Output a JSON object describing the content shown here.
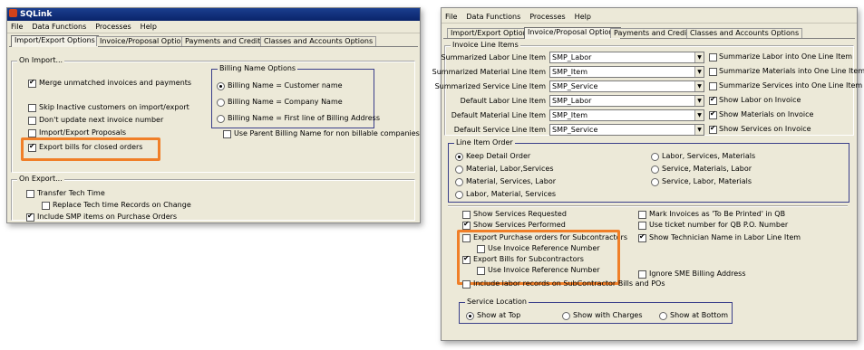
{
  "colors": {
    "highlight": "#f07f28",
    "title_bar": "#0a246a",
    "window_bg": "#ece9d8"
  },
  "left": {
    "app_title": "SQLink",
    "menu": [
      "File",
      "Data Functions",
      "Processes",
      "Help"
    ],
    "tabs": [
      "Import/Export Options",
      "Invoice/Proposal Options",
      "Payments and Credits",
      "Classes and Accounts Options"
    ],
    "on_import": {
      "label": "On Import...",
      "merge": {
        "label": "Merge unmatched invoices and payments",
        "checked": true
      },
      "skip_inactive": {
        "label": "Skip Inactive customers on import/export",
        "checked": false
      },
      "dont_update": {
        "label": "Don't update next invoice number",
        "checked": false
      },
      "import_export_proposals": {
        "label": "Import/Export Proposals",
        "checked": false
      },
      "export_bills_closed": {
        "label": "Export bills for closed orders",
        "checked": true
      }
    },
    "billing_name": {
      "label": "Billing Name Options",
      "options": [
        "Billing Name = Customer name",
        "Billing Name = Company Name",
        "Billing Name = First line of Billing Address"
      ],
      "selected_index": 0,
      "parent_billing": {
        "label": "Use Parent Billing Name for non billable companies",
        "checked": false
      }
    },
    "on_export": {
      "label": "On Export...",
      "transfer_tech": {
        "label": "Transfer Tech Time",
        "checked": false
      },
      "replace_tech": {
        "label": "Replace Tech time Records on Change",
        "checked": false
      },
      "include_smp": {
        "label": "Include SMP items on Purchase Orders",
        "checked": true
      }
    }
  },
  "right": {
    "menu": [
      "File",
      "Data Functions",
      "Processes",
      "Help"
    ],
    "tabs": [
      "Import/Export Options",
      "Invoice/Proposal Options",
      "Payments and Credits",
      "Classes and Accounts Options"
    ],
    "invoice_line_items": {
      "label": "Invoice Line Items",
      "rows": [
        {
          "label": "Summarized Labor Line Item",
          "value": "SMP_Labor",
          "check": "Summarize Labor into One Line Item",
          "checked": false
        },
        {
          "label": "Summarized Material Line Item",
          "value": "SMP_Item",
          "check": "Summarize Materials into One Line Item",
          "checked": false
        },
        {
          "label": "Summarized Service Line Item",
          "value": "SMP_Service",
          "check": "Summarize Services into One Line Item",
          "checked": false
        },
        {
          "label": "Default Labor Line Item",
          "value": "SMP_Labor",
          "check": "Show Labor on Invoice",
          "checked": true
        },
        {
          "label": "Default Material Line Item",
          "value": "SMP_Item",
          "check": "Show Materials on Invoice",
          "checked": true
        },
        {
          "label": "Default Service Line Item",
          "value": "SMP_Service",
          "check": "Show Services on Invoice",
          "checked": true
        }
      ]
    },
    "line_item_order": {
      "label": "Line Item Order",
      "left_options": [
        "Keep Detail Order",
        "Material, Labor,Services",
        "Material, Services, Labor",
        "Labor, Material, Services"
      ],
      "right_options": [
        "Labor, Services, Materials",
        "Service, Materials, Labor",
        "Service, Labor, Materials"
      ],
      "selected": "Keep Detail Order"
    },
    "checks": {
      "show_services_requested": {
        "label": "Show Services Requested",
        "checked": false
      },
      "show_services_performed": {
        "label": "Show Services Performed",
        "checked": true
      },
      "export_po_sub": {
        "label": "Export Purchase orders for Subcontractors",
        "checked": false
      },
      "use_inv_ref_1": {
        "label": "Use Invoice Reference Number",
        "checked": false
      },
      "export_bills_sub": {
        "label": "Export Bills for Subcontractors",
        "checked": true
      },
      "use_inv_ref_2": {
        "label": "Use Invoice Reference Number",
        "checked": false
      },
      "include_labor": {
        "label": "Include labor records on SubContractor Bills and POs",
        "checked": false
      },
      "mark_invoices": {
        "label": "Mark Invoices as 'To Be Printed' in QB",
        "checked": false
      },
      "use_ticket": {
        "label": "Use ticket number for QB P.O. Number",
        "checked": false
      },
      "show_tech_name": {
        "label": "Show Technician Name in Labor Line Item",
        "checked": true
      },
      "ignore_sme": {
        "label": "Ignore SME Billing Address",
        "checked": false
      }
    },
    "service_location": {
      "label": "Service Location",
      "options": [
        "Show at Top",
        "Show with Charges",
        "Show at Bottom"
      ],
      "selected_index": 0
    }
  }
}
